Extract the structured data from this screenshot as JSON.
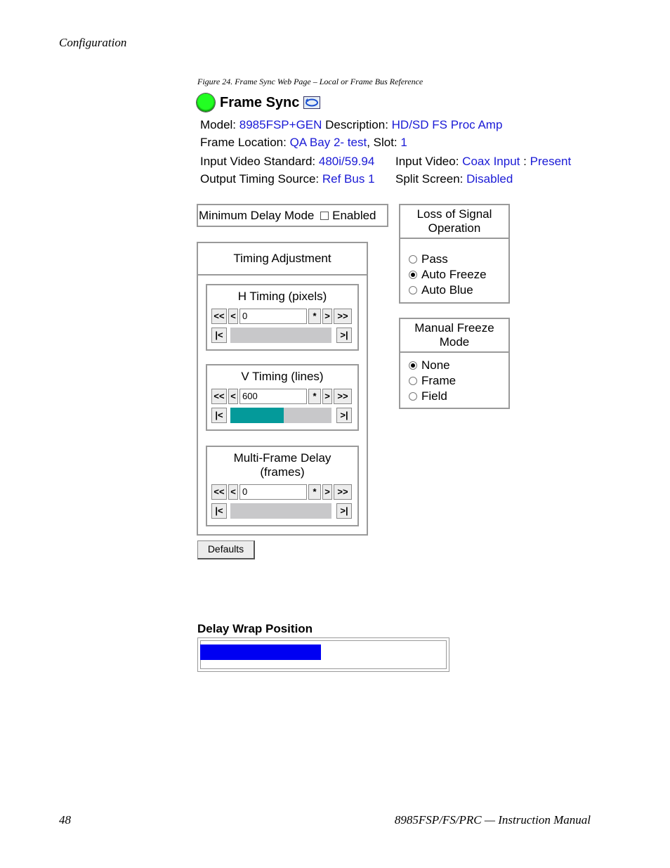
{
  "page": {
    "running_head": "Configuration",
    "caption": "Figure 24.  Frame Sync Web Page – Local or Frame Bus Reference",
    "page_number": "48",
    "footer_title": "8985FSP/FS/PRC — Instruction Manual"
  },
  "header": {
    "title": "Frame Sync",
    "icons": {
      "status": "status-led-green",
      "refresh": "refresh-icon"
    },
    "status_color": "#22ff22"
  },
  "info": {
    "model_label": "Model:",
    "model_value": "8985FSP+GEN",
    "description_label": "Description:",
    "description_value": "HD/SD FS Proc Amp",
    "frame_location_label": "Frame Location:",
    "frame_location_value": "QA Bay 2- test",
    "slot_label": ", Slot:",
    "slot_value": "1",
    "input_standard_label": "Input Video Standard:",
    "input_standard_value": "480i/59.94",
    "input_video_label": "Input Video:",
    "input_video_value": "Coax Input",
    "input_video_sep": ":",
    "input_video_status": "Present",
    "output_timing_label": "Output Timing Source:",
    "output_timing_value": "Ref Bus 1",
    "split_screen_label": "Split Screen:",
    "split_screen_value": "Disabled",
    "link_color": "#1a1ad6"
  },
  "min_delay": {
    "label": "Minimum Delay Mode",
    "checkbox_label": "Enabled",
    "checked": false
  },
  "timing": {
    "title": "Timing Adjustment",
    "buttons": {
      "fast_back": "<<",
      "back": "<",
      "reset": "*",
      "fwd": ">",
      "fast_fwd": ">>",
      "min": "|<",
      "max": ">|"
    },
    "h": {
      "label": "H Timing (pixels)",
      "value": "0",
      "fill_fraction": 0
    },
    "v": {
      "label": "V Timing (lines)",
      "value": "600",
      "fill_fraction": 0.53
    },
    "mf": {
      "label_line1": "Multi-Frame Delay",
      "label_line2": "(frames)",
      "value": "0",
      "fill_fraction": 0
    },
    "fill_color": "#049a9a"
  },
  "los": {
    "title_line1": "Loss of Signal",
    "title_line2": "Operation",
    "options": [
      "Pass",
      "Auto Freeze",
      "Auto Blue"
    ],
    "selected": 1
  },
  "mfm": {
    "title_line1": "Manual Freeze",
    "title_line2": "Mode",
    "options": [
      "None",
      "Frame",
      "Field"
    ],
    "selected": 0
  },
  "defaults": {
    "label": "Defaults"
  },
  "delay_wrap": {
    "label": "Delay Wrap Position",
    "fraction": 0.49,
    "color": "#0000f2"
  }
}
